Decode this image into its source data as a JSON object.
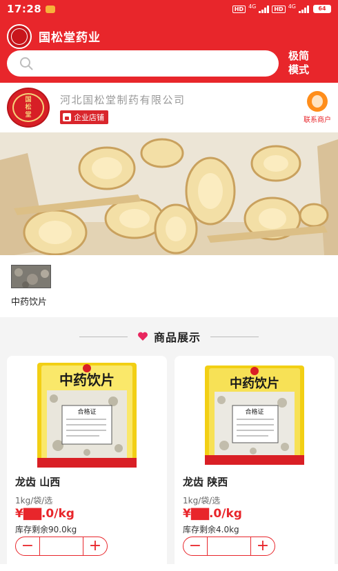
{
  "status_bar": {
    "time": "17:28",
    "hd1": "HD",
    "net1": "4G",
    "hd2": "HD",
    "net2": "4G",
    "battery": "64"
  },
  "header": {
    "title": "国松堂药业",
    "search": {
      "placeholder": ""
    },
    "mode_toggle": "极简\n模式"
  },
  "store": {
    "name": "河北国松堂制药有限公司",
    "badge": "企业店铺",
    "contact_label": "联系商户",
    "logo_text": [
      "国",
      "松",
      "堂"
    ]
  },
  "category": {
    "items": [
      {
        "label": "中药饮片"
      }
    ]
  },
  "section": {
    "title": "商品展示"
  },
  "products": [
    {
      "name": "龙齿 山西",
      "spec": "1kg/袋/选",
      "price": "¥▇▇.0/kg",
      "stock": "库存剩余90.0kg",
      "package_title": "中药饮片",
      "package_cert": "合格证"
    },
    {
      "name": "龙齿 陕西",
      "spec": "1kg/袋/选",
      "price": "¥▇▇.0/kg",
      "stock": "库存剩余4.0kg",
      "package_title": "中药饮片",
      "package_cert": "合格证"
    }
  ],
  "colors": {
    "brand_red": "#e8262b",
    "package_yellow": "#f2cf14"
  }
}
